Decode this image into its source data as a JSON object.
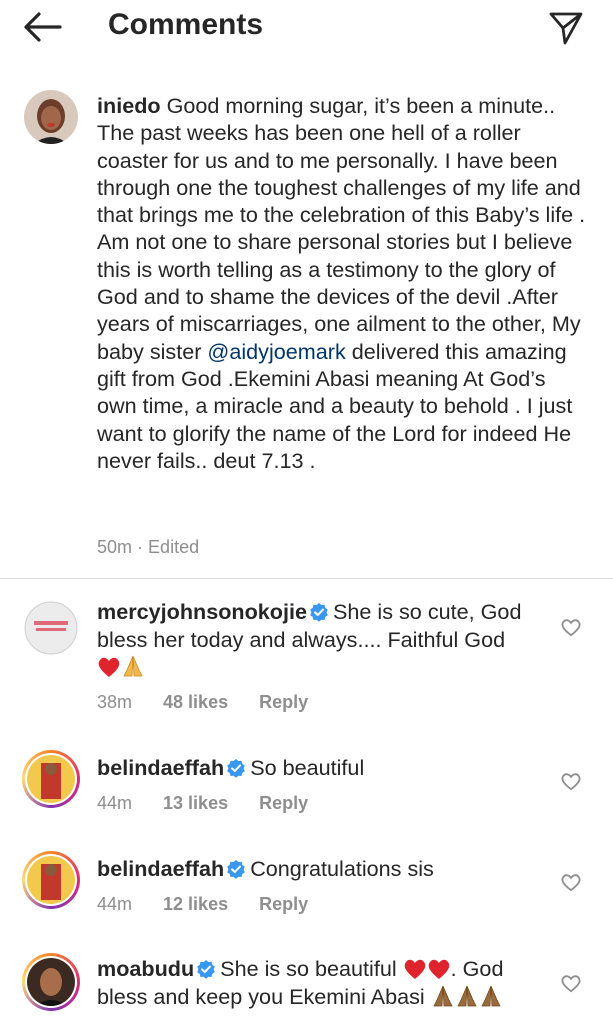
{
  "header": {
    "title": "Comments"
  },
  "caption": {
    "username": "iniedo",
    "text_before": "Good morning sugar, it’s been a minute.. The past weeks has been one hell of a roller coaster for us and to me personally. I have been through one the toughest challenges of my life and that brings me to the celebration of this Baby’s life . Am not one to share personal stories but I believe this is worth telling as a testimony to the glory of God and to shame the devices of the devil .After years of miscarriages, one ailment to the other, My baby sister ",
    "mention": "@aidyjoemark",
    "text_after": " delivered this amazing gift from God .Ekemini Abasi meaning At God’s own time, a miracle and a beauty to behold . I just want to glorify the name of the Lord for indeed He never fails.. deut 7.13 .",
    "time": "50m",
    "separator": "·",
    "edited": "Edited"
  },
  "comments": [
    {
      "username": "mercyjohnsonokojie",
      "text": "She is so cute, God bless her today and always.... Faithful God",
      "time": "38m",
      "likes": "48 likes",
      "reply": "Reply"
    },
    {
      "username": "belindaeffah",
      "text": "So beautiful",
      "time": "44m",
      "likes": "13 likes",
      "reply": "Reply"
    },
    {
      "username": "belindaeffah",
      "text": "Congratulations sis",
      "time": "44m",
      "likes": "12 likes",
      "reply": "Reply"
    },
    {
      "username": "moabudu",
      "text": "She is so beautiful",
      "text_after": ". God bless and keep you Ekemini Abasi"
    }
  ],
  "icons": {
    "back": "arrow-left-icon",
    "share": "paper-plane-icon",
    "verified": "verified-badge-icon",
    "like": "heart-outline-icon"
  },
  "colors": {
    "verified": "#3897f0",
    "mention": "#003569",
    "meta": "#8e8e8e",
    "heart": "#ed4956"
  }
}
